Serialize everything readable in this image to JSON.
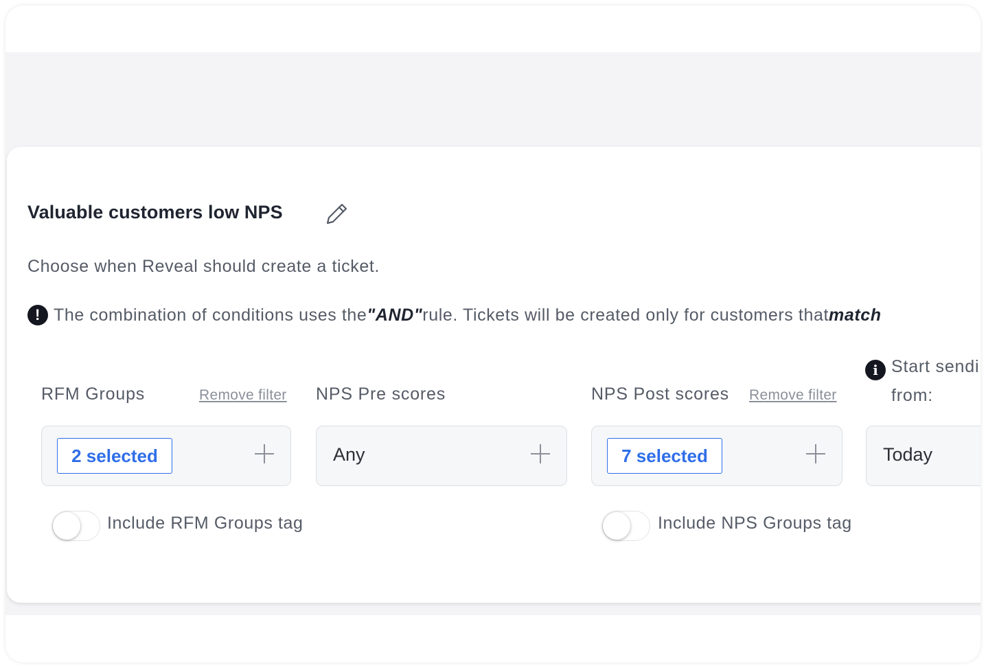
{
  "card": {
    "title": "Valuable customers low NPS",
    "subtitle": "Choose when Reveal should create a ticket.",
    "notice": {
      "prefix": "The combination of conditions uses the ",
      "rule": "\"AND\"",
      "middle": " rule. Tickets will be created only for customers that ",
      "emph": "match"
    }
  },
  "filters": [
    {
      "label": "RFM Groups",
      "remove": "Remove filter",
      "value": "2 selected",
      "toggle_label": "Include RFM Groups tag"
    },
    {
      "label": "NPS Pre scores",
      "value": "Any"
    },
    {
      "label": "NPS Post scores",
      "remove": "Remove filter",
      "value": "7 selected",
      "toggle_label": "Include NPS Groups tag"
    }
  ],
  "start": {
    "label_line1": "Start sending",
    "label_line2": "from:",
    "value": "Today"
  },
  "icons": {
    "edit": "pencil-icon",
    "warning": "exclamation-icon",
    "info": "info-icon",
    "add": "plus-icon"
  },
  "colors": {
    "accent": "#2f6ee8",
    "background": "#f4f4f6"
  }
}
